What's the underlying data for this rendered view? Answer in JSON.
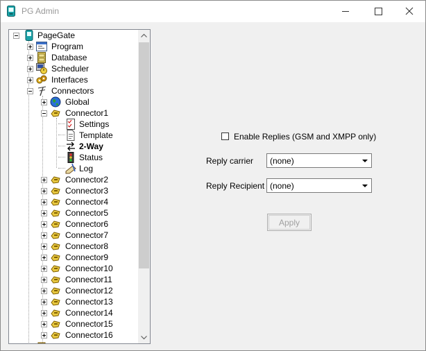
{
  "window": {
    "title": "PG Admin"
  },
  "tree": {
    "root": "PageGate",
    "top_items": [
      "Program",
      "Database",
      "Scheduler",
      "Interfaces",
      "Connectors"
    ],
    "connectors_children": [
      "Global",
      "Connector1"
    ],
    "connector1_children": [
      "Settings",
      "Template",
      "2-Way",
      "Status",
      "Log"
    ],
    "more_connectors": [
      "Connector2",
      "Connector3",
      "Connector4",
      "Connector5",
      "Connector6",
      "Connector7",
      "Connector8",
      "Connector9",
      "Connector10",
      "Connector11",
      "Connector12",
      "Connector13",
      "Connector14",
      "Connector15",
      "Connector16"
    ]
  },
  "form": {
    "enable_replies_label": "Enable Replies (GSM and XMPP only)",
    "reply_carrier_label": "Reply carrier",
    "reply_carrier_value": "(none)",
    "reply_recipient_label": "Reply Recipient",
    "reply_recipient_value": "(none)",
    "apply_label": "Apply"
  }
}
